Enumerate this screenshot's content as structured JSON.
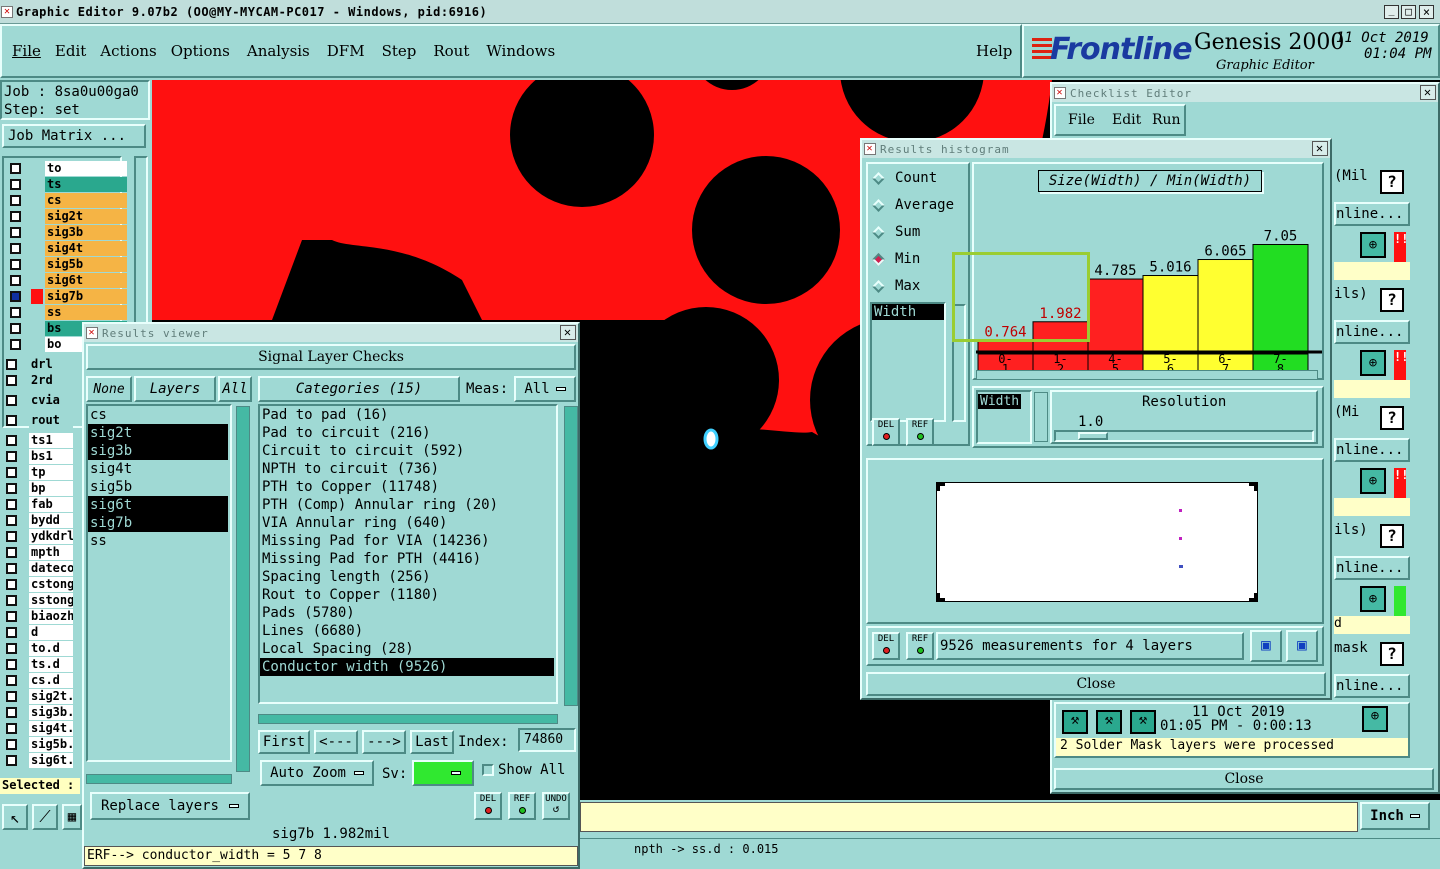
{
  "window": {
    "title": "Graphic Editor 9.07b2 (OO@MY-MYCAM-PC017 - Windows, pid:6916)",
    "controls": [
      "_",
      "□",
      "×"
    ]
  },
  "menu": [
    "File",
    "Edit",
    "Actions",
    "Options",
    "Analysis",
    "DFM",
    "Step",
    "Rout",
    "Windows"
  ],
  "help": "Help",
  "brand": {
    "logo": "Frontline",
    "product": "Genesis 2000",
    "subtitle": "Graphic Editor",
    "date": "11 Oct 2019",
    "time": "01:04 PM"
  },
  "job": {
    "job": "Job : 8sa0u00ga0",
    "step": "Step: set",
    "matrix_button": "Job Matrix ...",
    "selected": "Selected :"
  },
  "layers": [
    {
      "name": "to",
      "color": "#ffffff"
    },
    {
      "name": "ts",
      "color": "#2aa88e"
    },
    {
      "name": "cs",
      "color": "#f5b445"
    },
    {
      "name": "sig2t",
      "color": "#f5b445"
    },
    {
      "name": "sig3b",
      "color": "#f5b445"
    },
    {
      "name": "sig4t",
      "color": "#f5b445"
    },
    {
      "name": "sig5b",
      "color": "#f5b445"
    },
    {
      "name": "sig6t",
      "color": "#f5b445"
    },
    {
      "name": "sig7b",
      "color": "#f5b445"
    },
    {
      "name": "ss",
      "color": "#f5b445"
    },
    {
      "name": "bs",
      "color": "#2aa88e"
    },
    {
      "name": "bo",
      "color": "#ffffff"
    }
  ],
  "layers2": [
    "drl",
    "2rd",
    "cvia",
    "rout",
    "ts1",
    "bs1",
    "tp",
    "bp",
    "fab",
    "bydd",
    "ydkdrl",
    "mpth",
    "datecod",
    "cstong",
    "sstong",
    "biaozh",
    "d",
    "to.d",
    "ts.d",
    "cs.d",
    "sig2t.",
    "sig3b.",
    "sig4t.",
    "sig5b.",
    "sig6t."
  ],
  "results_viewer": {
    "title": "Results viewer",
    "heading": "Signal Layer Checks",
    "btn_none": "None",
    "btn_layers": "Layers",
    "btn_all": "All",
    "categories_label": "Categories (15)",
    "meas_label": "Meas:",
    "meas_value": "All",
    "layer_list": [
      {
        "name": "cs",
        "selected": false
      },
      {
        "name": "sig2t",
        "selected": true
      },
      {
        "name": "sig3b",
        "selected": true
      },
      {
        "name": "sig4t",
        "selected": false
      },
      {
        "name": "sig5b",
        "selected": false
      },
      {
        "name": "sig6t",
        "selected": true
      },
      {
        "name": "sig7b",
        "selected": true
      },
      {
        "name": "ss",
        "selected": false
      }
    ],
    "categories": [
      {
        "name": "Pad to pad (16)",
        "selected": false
      },
      {
        "name": "Pad to circuit (216)",
        "selected": false
      },
      {
        "name": "Circuit to circuit (592)",
        "selected": false
      },
      {
        "name": "NPTH to circuit (736)",
        "selected": false
      },
      {
        "name": "PTH to Copper (11748)",
        "selected": false
      },
      {
        "name": "PTH (Comp) Annular ring (20)",
        "selected": false
      },
      {
        "name": "VIA Annular ring (640)",
        "selected": false
      },
      {
        "name": "Missing Pad for VIA (14236)",
        "selected": false
      },
      {
        "name": "Missing Pad for PTH (4416)",
        "selected": false
      },
      {
        "name": "Spacing length (256)",
        "selected": false
      },
      {
        "name": "Rout to Copper (1180)",
        "selected": false
      },
      {
        "name": "Pads (5780)",
        "selected": false
      },
      {
        "name": "Lines (6680)",
        "selected": false
      },
      {
        "name": "Local Spacing (28)",
        "selected": false
      },
      {
        "name": "Conductor width (9526)",
        "selected": true
      }
    ],
    "nav": {
      "first": "First",
      "prev": "<---",
      "next": "--->",
      "last": "Last",
      "index_label": "Index:",
      "index_value": "74860"
    },
    "auto_zoom": "Auto Zoom",
    "sv_label": "Sv:",
    "show_all": "Show All",
    "replace_layers": "Replace layers",
    "del": "DEL",
    "ref": "REF",
    "undo": "UNDO",
    "status": "sig7b 1.982mil",
    "erf": "ERF--> conductor_width = 5 7 8"
  },
  "histogram": {
    "title": "Results histogram",
    "modes": [
      {
        "label": "Count",
        "on": false
      },
      {
        "label": "Average",
        "on": false
      },
      {
        "label": "Sum",
        "on": false
      },
      {
        "label": "Min",
        "on": true
      },
      {
        "label": "Max",
        "on": false
      }
    ],
    "measure": "Width",
    "chart_title": "Size(Width) / Min(Width)",
    "width_label": "Width",
    "resolution_label": "Resolution",
    "resolution_value": "1.0",
    "footer": "9526 measurements for 4 layers",
    "close": "Close",
    "del": "DEL",
    "ref": "REF"
  },
  "chart_data": {
    "type": "bar",
    "title": "Size(Width) / Min(Width)",
    "categories": [
      "0-1",
      "1-2",
      "4-5",
      "5-6",
      "6-7",
      "7-8"
    ],
    "values": [
      0.764,
      1.982,
      4.785,
      5.016,
      6.065,
      7.05
    ],
    "labels": [
      "0.764",
      "1.982",
      "4.785",
      "5.016",
      "6.065",
      "7.05"
    ],
    "colors": [
      "#ff2020",
      "#ff2020",
      "#ff2020",
      "#ffff30",
      "#ffff30",
      "#22dd22"
    ],
    "value_label_colors": [
      "#c00000",
      "#c00000",
      "#000000",
      "#000000",
      "#000000",
      "#000000"
    ],
    "ylim": [
      0,
      8
    ]
  },
  "checklist": {
    "title": "Checklist Editor",
    "menu": [
      "File",
      "Edit",
      "Run"
    ],
    "side_texts": [
      "(Mil",
      "nline...",
      "ils)",
      "nline...",
      "(Mi",
      "nline...",
      "ils)",
      "nline...",
      "d",
      "mask",
      "nline..."
    ],
    "date": "11 Oct 2019",
    "time": "01:05 PM - 0:00:13",
    "message": "2 Solder Mask layers were processed",
    "close": "Close"
  },
  "bottom": {
    "units": "Inch",
    "status": "npth -> ss.d : 0.015"
  }
}
